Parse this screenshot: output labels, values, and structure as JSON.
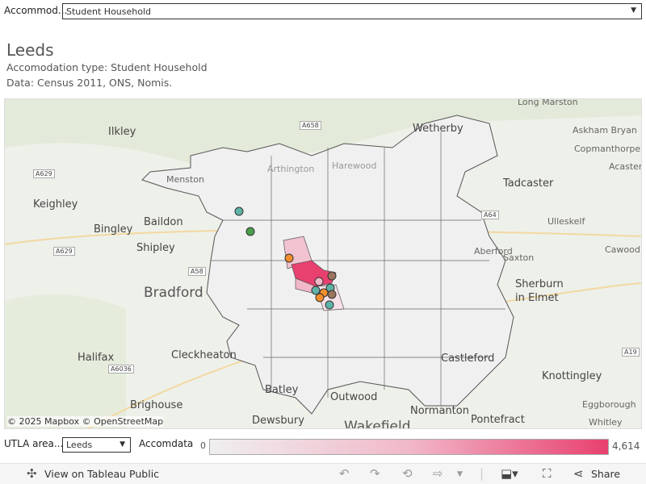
{
  "filter": {
    "label": "Accommod...",
    "value": "Student Household"
  },
  "header": {
    "title": "Leeds",
    "subtitle": "Accomodation type: Student Household",
    "source": "Data: Census 2011, ONS, Nomis."
  },
  "map": {
    "places": [
      "Long Marston",
      "Wetherby",
      "Askham Bryan",
      "Copmanthorpe",
      "Acaster",
      "Ilkley",
      "Tadcaster",
      "Keighley",
      "Baildon",
      "Bingley",
      "Shipley",
      "Ulleskelf",
      "Saxton",
      "Cawood",
      "Bradford",
      "Sherburn",
      "in Elmet",
      "Aberford",
      "Halifax",
      "Cleckheaton",
      "Castleford",
      "Knottingley",
      "Eggborough",
      "Brighouse",
      "Batley",
      "Outwood",
      "Normanton",
      "Pontefract",
      "Whitley",
      "Dewsbury",
      "Wakefield",
      "Harewood",
      "Arthington",
      "Menston"
    ],
    "roads": [
      "A658",
      "A629",
      "A64",
      "A6036",
      "A19",
      "A58",
      "A629"
    ],
    "attribution": "© 2025 Mapbox © OpenStreetMap",
    "fill_colors": {
      "low": "#efefef",
      "mid": "#f1b8c9",
      "high": "#e8406f"
    },
    "marker_colors": {
      "teal": "#5fb3a6",
      "green": "#4a9e4a",
      "orange": "#f28e2b",
      "brown": "#9c755f"
    }
  },
  "utla": {
    "label": "UTLA area...",
    "value": "Leeds"
  },
  "legend": {
    "title": "Accomdata",
    "min": "0",
    "max": "4,614"
  },
  "toolbar": {
    "view_label": "View on Tableau Public",
    "share_label": "Share"
  }
}
